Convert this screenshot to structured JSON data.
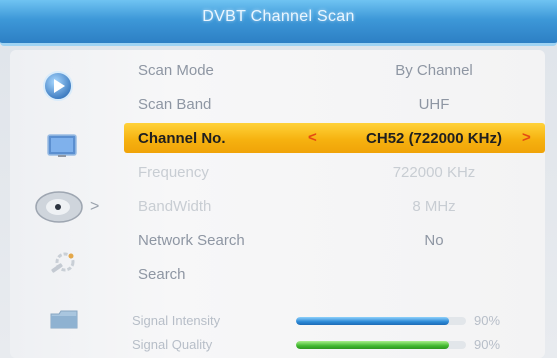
{
  "header": {
    "title": "DVBT Channel Scan"
  },
  "sidebar": {
    "icons": [
      "play-icon",
      "tv-icon",
      "satellite-dish-icon",
      "tools-icon",
      "folder-icon"
    ],
    "active_arrow": ">"
  },
  "settings": {
    "scan_mode": {
      "label": "Scan Mode",
      "value": "By Channel"
    },
    "scan_band": {
      "label": "Scan Band",
      "value": "UHF"
    },
    "channel_no": {
      "label": "Channel No.",
      "value": "CH52 (722000 KHz)",
      "left_arrow": "<",
      "right_arrow": ">"
    },
    "frequency": {
      "label": "Frequency",
      "value": "722000 KHz"
    },
    "bandwidth": {
      "label": "BandWidth",
      "value": "8 MHz"
    },
    "network_search": {
      "label": "Network Search",
      "value": "No"
    },
    "search": {
      "label": "Search"
    }
  },
  "signal": {
    "intensity": {
      "label": "Signal Intensity",
      "percent_text": "90%",
      "level": 0.9
    },
    "quality": {
      "label": "Signal Quality",
      "percent_text": "90%",
      "level": 0.9
    }
  },
  "colors": {
    "title_bar": "#3d98d8",
    "highlight": "#f6b210",
    "arrow_accent": "#e44b12",
    "intensity_bar": "#2b88d6",
    "quality_bar": "#41b82f"
  }
}
